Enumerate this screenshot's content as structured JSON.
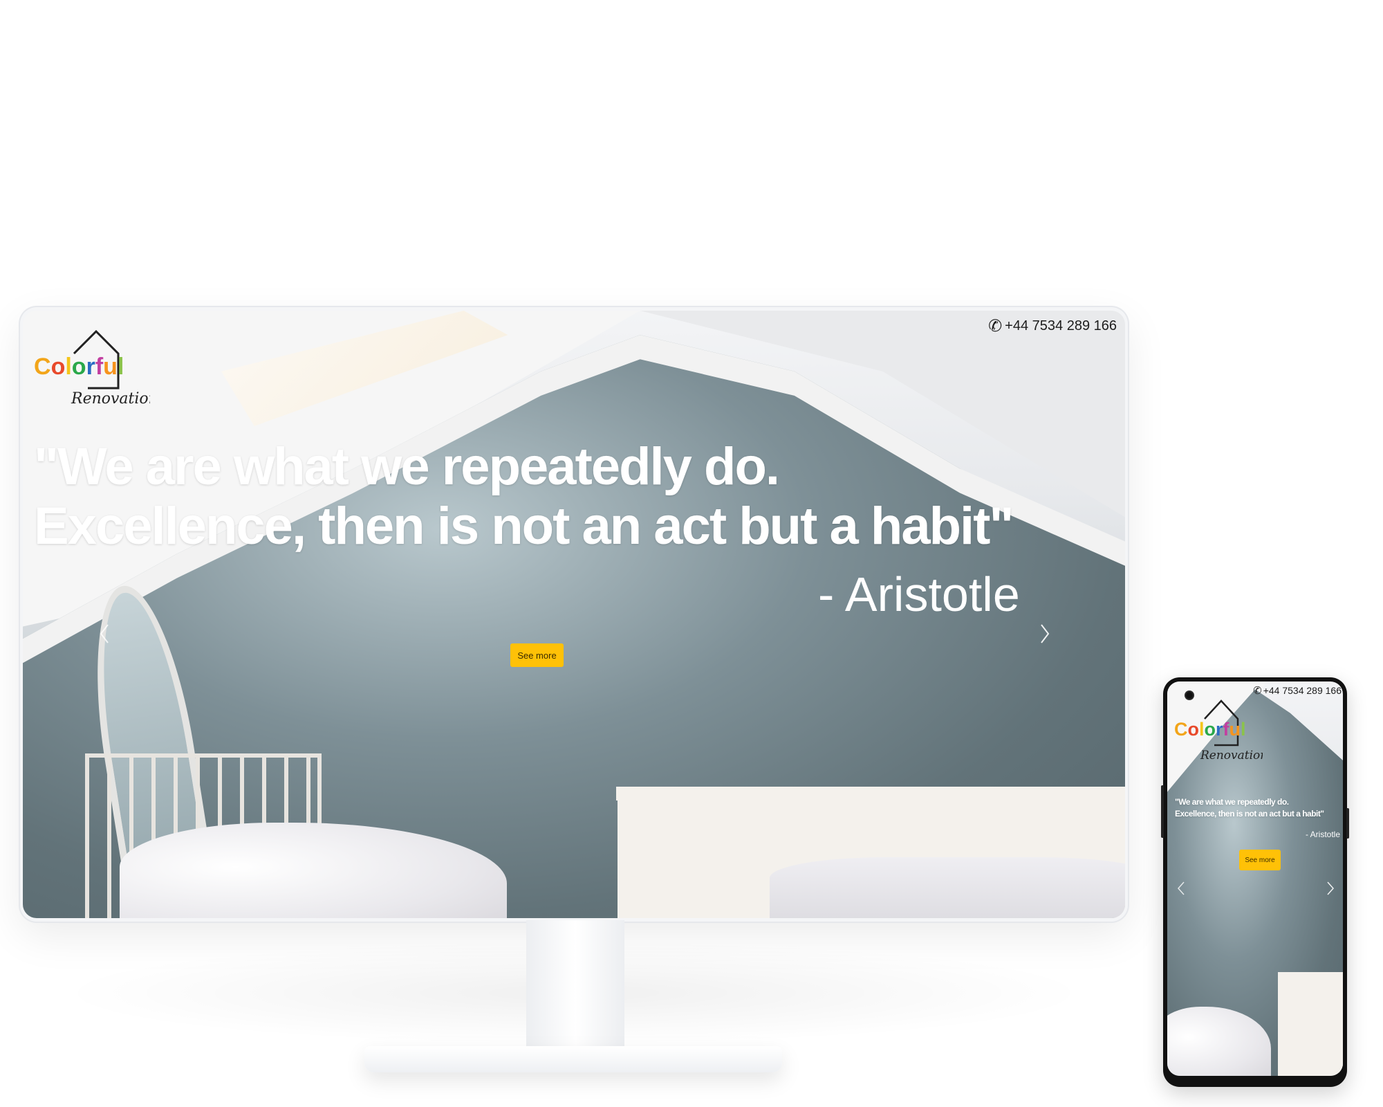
{
  "brand": {
    "logo_letters": [
      "C",
      "o",
      "l",
      "o",
      "r",
      "f",
      "u",
      "l"
    ],
    "logo_colors": [
      "#f2a51a",
      "#e84a2c",
      "#f4c51a",
      "#2aa84a",
      "#2b6cc4",
      "#c23fa1",
      "#f7941d",
      "#8bc34a"
    ],
    "script_text": "Renovation"
  },
  "contact": {
    "phone": "+44 7534 289 166",
    "phone_icon": "phone-icon"
  },
  "hero": {
    "quote_line1": "\"We are what we repeatedly do.",
    "quote_line2": "Excellence, then is not an act but a habit\"",
    "author": "- Aristotle",
    "cta_label": "See more"
  },
  "carousel": {
    "prev_icon": "chevron-left-icon",
    "next_icon": "chevron-right-icon"
  },
  "colors": {
    "accent": "#ffc107",
    "text": "#ffffff",
    "wall": "#627379"
  }
}
